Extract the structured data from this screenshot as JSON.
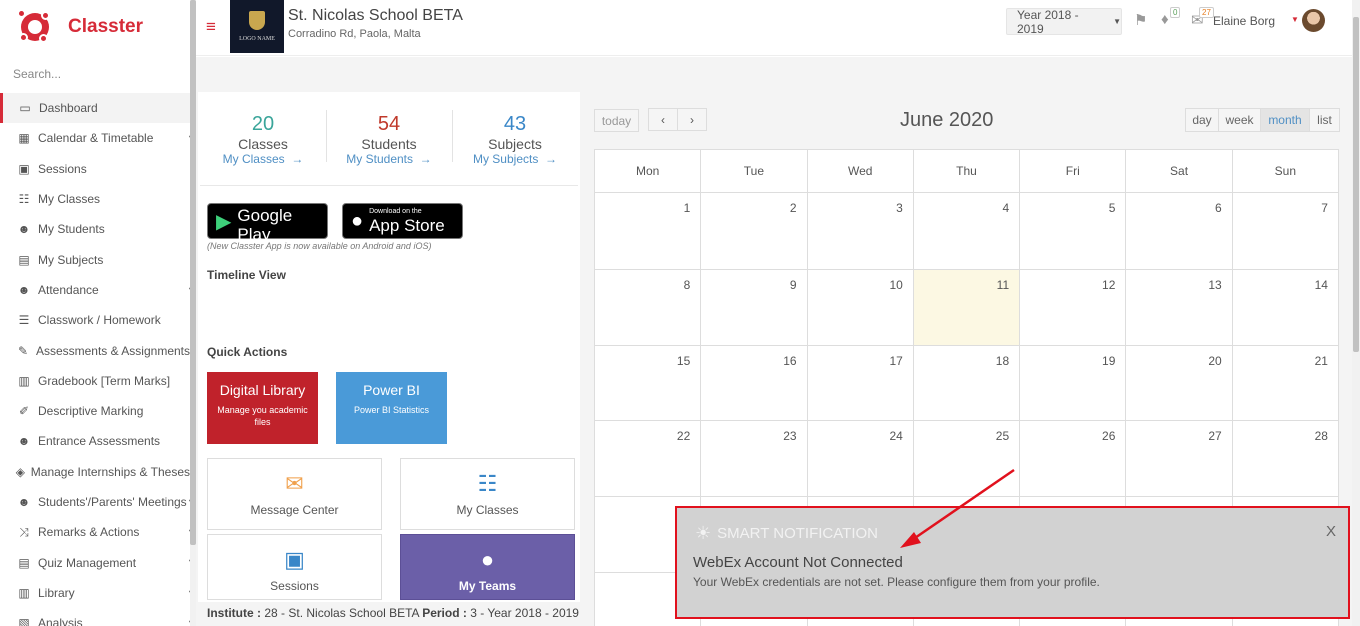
{
  "sidebar": {
    "brand": "Classter",
    "search_placeholder": "Search...",
    "items": [
      {
        "label": "Dashboard",
        "icon": "monitor-icon",
        "active": true
      },
      {
        "label": "Calendar & Timetable",
        "icon": "calendar-icon",
        "chevron": true
      },
      {
        "label": "Sessions",
        "icon": "sessions-icon"
      },
      {
        "label": "My Classes",
        "icon": "classes-icon"
      },
      {
        "label": "My Students",
        "icon": "students-icon"
      },
      {
        "label": "My Subjects",
        "icon": "book-icon"
      },
      {
        "label": "Attendance",
        "icon": "attendance-icon",
        "chevron": true
      },
      {
        "label": "Classwork / Homework",
        "icon": "list-icon"
      },
      {
        "label": "Assessments & Assignments",
        "icon": "pencil-icon"
      },
      {
        "label": "Gradebook [Term Marks]",
        "icon": "gradebook-icon"
      },
      {
        "label": "Descriptive Marking",
        "icon": "marking-icon"
      },
      {
        "label": "Entrance Assessments",
        "icon": "entrance-icon"
      },
      {
        "label": "Manage Internships & Theses",
        "icon": "box-icon"
      },
      {
        "label": "Students'/Parents' Meetings",
        "icon": "meeting-icon",
        "chevron": true
      },
      {
        "label": "Remarks & Actions",
        "icon": "shuffle-icon",
        "chevron": true
      },
      {
        "label": "Quiz Management",
        "icon": "quiz-icon",
        "chevron": true
      },
      {
        "label": "Library",
        "icon": "library-icon",
        "chevron": true
      },
      {
        "label": "Analysis",
        "icon": "analysis-icon",
        "chevron": true
      }
    ]
  },
  "header": {
    "school_name": "St. Nicolas School BETA",
    "school_address": "Corradino Rd, Paola, Malta",
    "logo_text": "LOGO NAME",
    "year_select": "Year 2018 - 2019",
    "notifications_count": "0",
    "messages_count": "27",
    "user_name": "Elaine Borg"
  },
  "stats": [
    {
      "number": "20",
      "label": "Classes",
      "link": "My Classes",
      "color": "#3aa59a"
    },
    {
      "number": "54",
      "label": "Students",
      "link": "My Students",
      "color": "#c0392b"
    },
    {
      "number": "43",
      "label": "Subjects",
      "link": "My Subjects",
      "color": "#3a87c8"
    }
  ],
  "stores": {
    "google_small": "GET IT ON",
    "google_large": "Google Play",
    "apple_small": "Download on the",
    "apple_large": "App Store",
    "note": "(New Classter App is now available on Android and iOS)"
  },
  "timeline_title": "Timeline View",
  "quick_actions": {
    "title": "Quick Actions",
    "digital_library": {
      "title": "Digital Library",
      "sub": "Manage you academic files"
    },
    "power_bi": {
      "title": "Power BI",
      "sub": "Power BI Statistics"
    },
    "tiles": [
      "Message Center",
      "My Classes",
      "Sessions",
      "My Teams"
    ]
  },
  "footer": {
    "institute_label": "Institute :",
    "institute_value": "28 - St. Nicolas School BETA",
    "period_label": "Period :",
    "period_value": "3 - Year 2018 - 2019"
  },
  "calendar": {
    "today_label": "today",
    "prev_label": "‹",
    "next_label": "›",
    "title": "June 2020",
    "views": [
      "day",
      "week",
      "month",
      "list"
    ],
    "active_view": "month",
    "weekdays": [
      "Mon",
      "Tue",
      "Wed",
      "Thu",
      "Fri",
      "Sat",
      "Sun"
    ],
    "weeks": [
      [
        "1",
        "2",
        "3",
        "4",
        "5",
        "6",
        "7"
      ],
      [
        "8",
        "9",
        "10",
        "11",
        "12",
        "13",
        "14"
      ],
      [
        "15",
        "16",
        "17",
        "18",
        "19",
        "20",
        "21"
      ],
      [
        "22",
        "23",
        "24",
        "25",
        "26",
        "27",
        "28"
      ],
      [
        "",
        "",
        "",
        "",
        "",
        "",
        ""
      ],
      [
        "",
        "",
        "",
        "",
        "",
        "",
        ""
      ]
    ],
    "today_date": "11"
  },
  "notification": {
    "header": "SMART NOTIFICATION",
    "close": "X",
    "title": "WebEx Account Not Connected",
    "message": "Your WebEx credentials are not set. Please configure them from your profile."
  },
  "colors": {
    "brand_red": "#d62b38",
    "link_blue": "#4f8fc4",
    "highlight_red": "#e1111d",
    "teams_purple": "#6b5fa8"
  }
}
